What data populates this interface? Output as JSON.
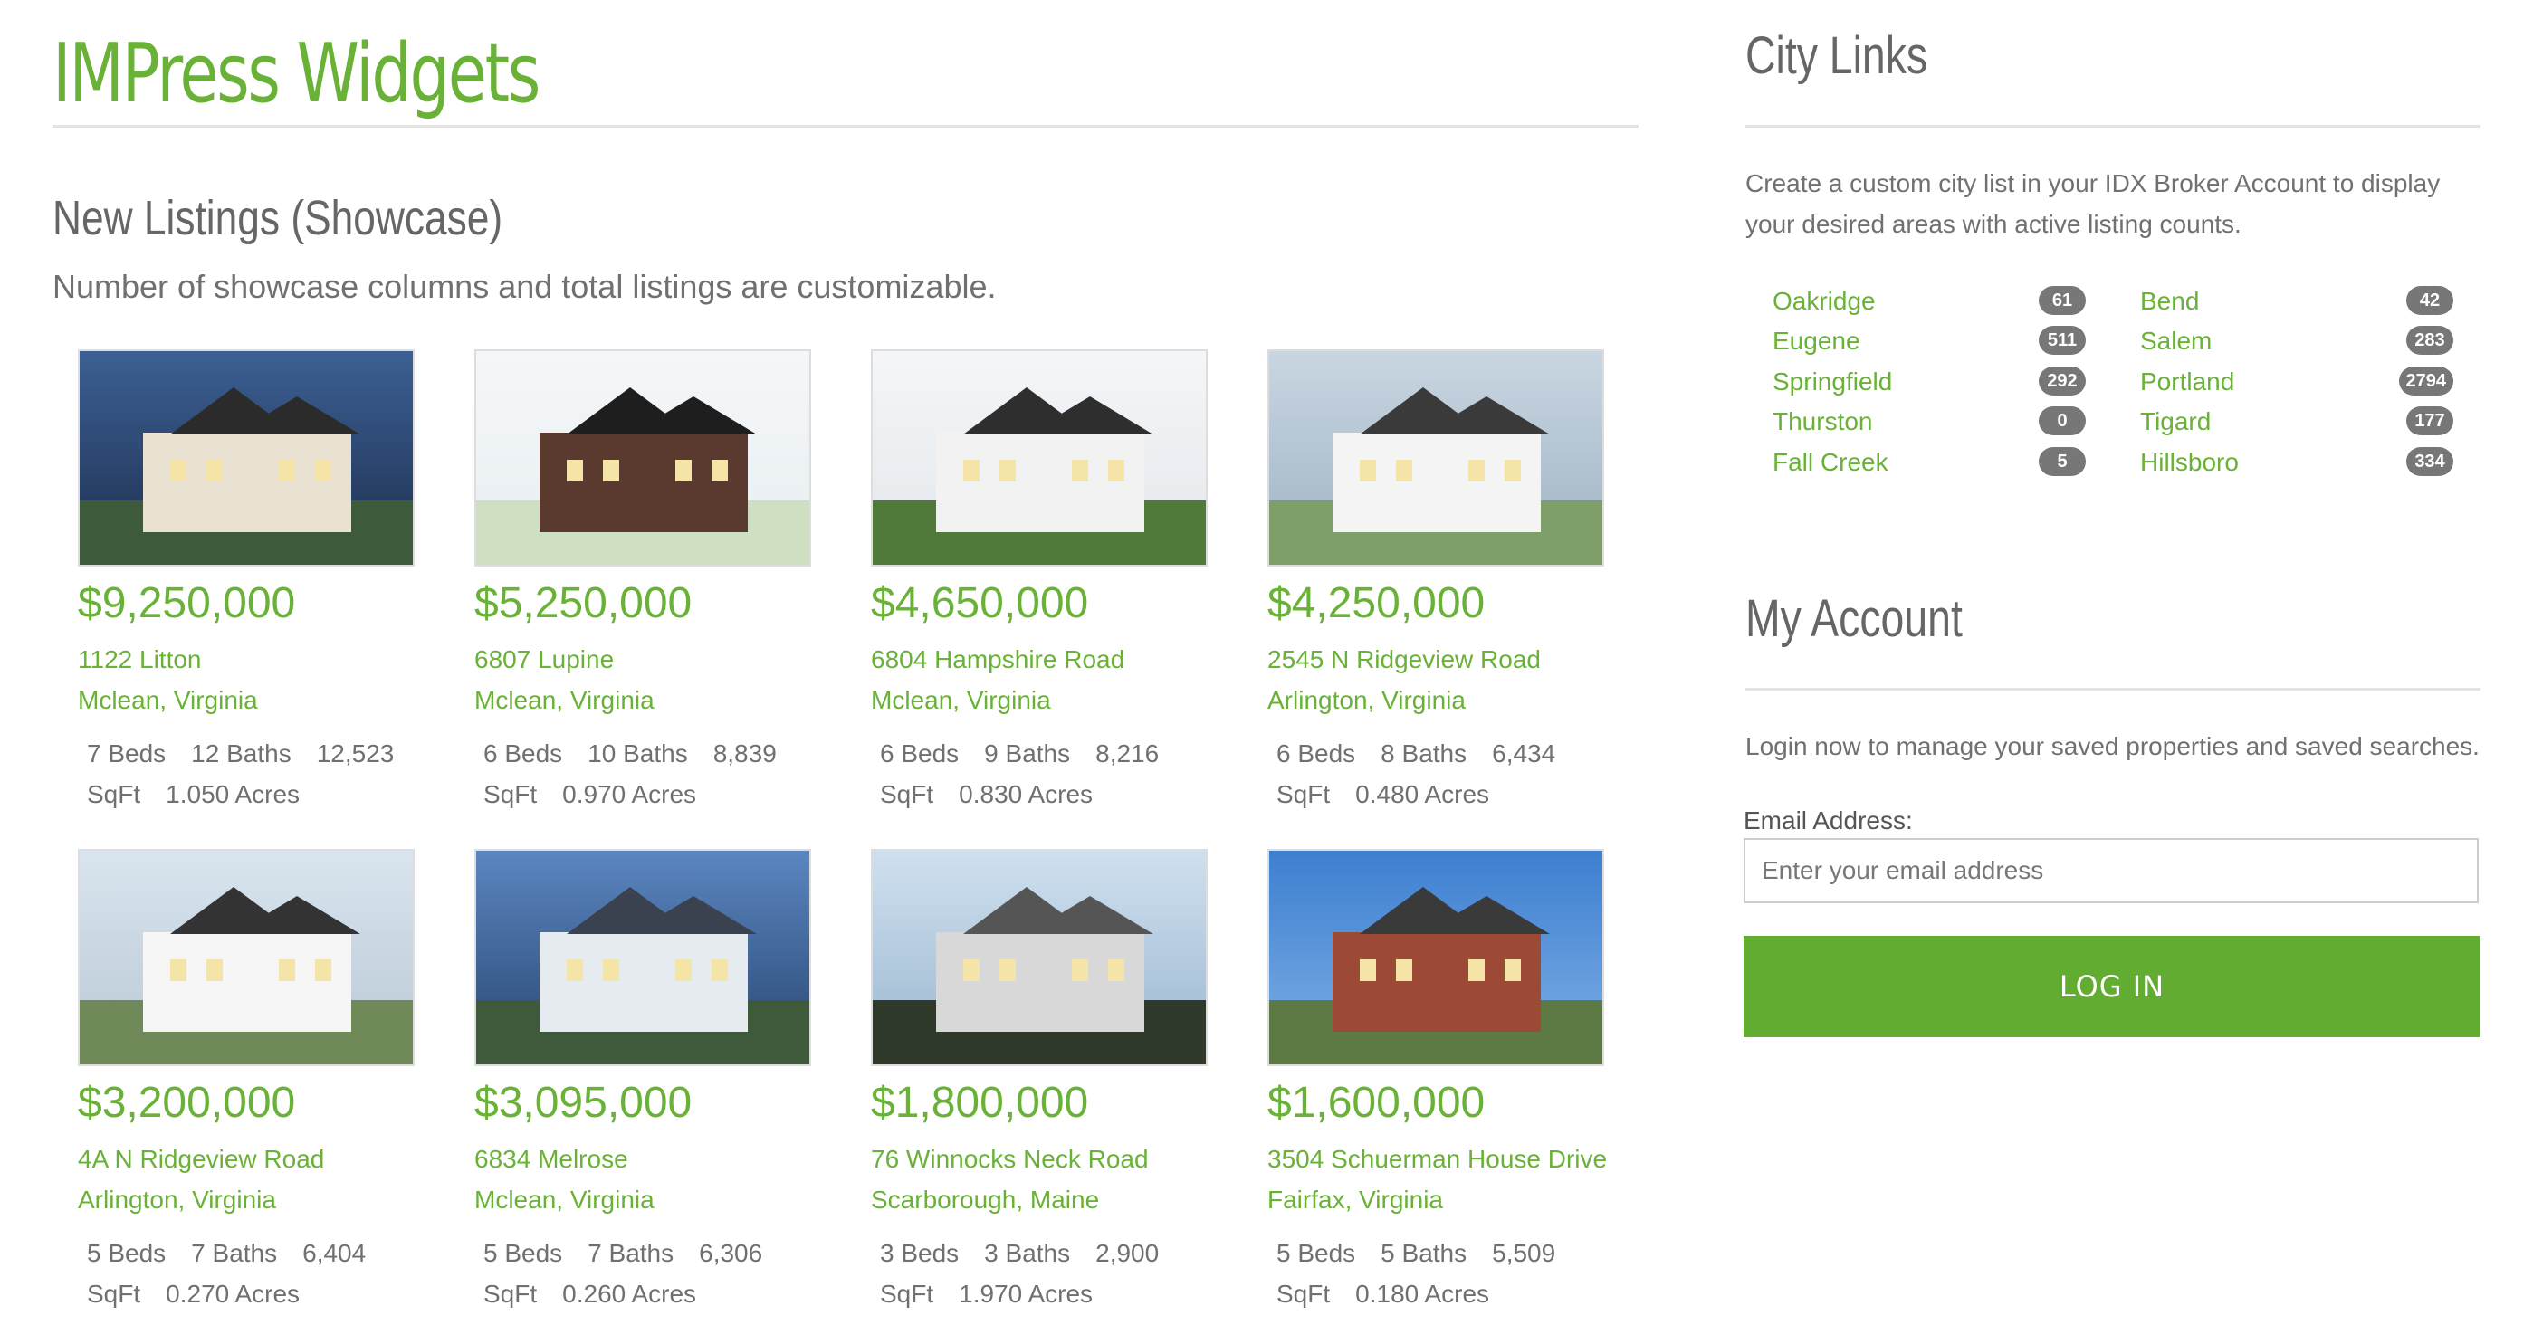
{
  "site": {
    "title": "IMPress Widgets"
  },
  "showcase": {
    "title": "New Listings (Showcase)",
    "description": "Number of showcase columns and total listings are customizable.",
    "listings": [
      {
        "price": "$9,250,000",
        "address": "1122 Litton",
        "city": "Mclean, Virginia",
        "beds": "7 Beds",
        "baths": "12 Baths",
        "sqft": "12,523 SqFt",
        "acres": "1.050 Acres"
      },
      {
        "price": "$5,250,000",
        "address": "6807 Lupine",
        "city": "Mclean, Virginia",
        "beds": "6 Beds",
        "baths": "10 Baths",
        "sqft": "8,839 SqFt",
        "acres": "0.970 Acres"
      },
      {
        "price": "$4,650,000",
        "address": "6804 Hampshire Road",
        "city": "Mclean, Virginia",
        "beds": "6 Beds",
        "baths": "9 Baths",
        "sqft": "8,216 SqFt",
        "acres": "0.830 Acres"
      },
      {
        "price": "$4,250,000",
        "address": "2545 N Ridgeview Road",
        "city": "Arlington, Virginia",
        "beds": "6 Beds",
        "baths": "8 Baths",
        "sqft": "6,434 SqFt",
        "acres": "0.480 Acres"
      },
      {
        "price": "$3,200,000",
        "address": "4A N Ridgeview Road",
        "city": "Arlington, Virginia",
        "beds": "5 Beds",
        "baths": "7 Baths",
        "sqft": "6,404 SqFt",
        "acres": "0.270 Acres"
      },
      {
        "price": "$3,095,000",
        "address": "6834 Melrose",
        "city": "Mclean, Virginia",
        "beds": "5 Beds",
        "baths": "7 Baths",
        "sqft": "6,306 SqFt",
        "acres": "0.260 Acres"
      },
      {
        "price": "$1,800,000",
        "address": "76 Winnocks Neck Road",
        "city": "Scarborough, Maine",
        "beds": "3 Beds",
        "baths": "3 Baths",
        "sqft": "2,900 SqFt",
        "acres": "1.970 Acres"
      },
      {
        "price": "$1,600,000",
        "address": "3504 Schuerman House Drive",
        "city": "Fairfax, Virginia",
        "beds": "5 Beds",
        "baths": "5 Baths",
        "sqft": "5,509 SqFt",
        "acres": "0.180 Acres"
      }
    ]
  },
  "city_links": {
    "title": "City Links",
    "description": "Create a custom city list in your IDX Broker Account to display your desired areas with active listing counts.",
    "cities": [
      {
        "name": "Oakridge",
        "count": "61"
      },
      {
        "name": "Eugene",
        "count": "511"
      },
      {
        "name": "Springfield",
        "count": "292"
      },
      {
        "name": "Thurston",
        "count": "0"
      },
      {
        "name": "Fall Creek",
        "count": "5"
      },
      {
        "name": "Bend",
        "count": "42"
      },
      {
        "name": "Salem",
        "count": "283"
      },
      {
        "name": "Portland",
        "count": "2794"
      },
      {
        "name": "Tigard",
        "count": "177"
      },
      {
        "name": "Hillsboro",
        "count": "334"
      }
    ]
  },
  "account": {
    "title": "My Account",
    "description": "Login now to manage your saved properties and saved searches.",
    "email_label": "Email Address:",
    "email_placeholder": "Enter your email address",
    "email_value": "",
    "login_label": "LOG IN"
  },
  "colors": {
    "accent": "#6ab237",
    "button": "#62ac32",
    "badge": "#777777",
    "rule": "#e3e3e3"
  }
}
